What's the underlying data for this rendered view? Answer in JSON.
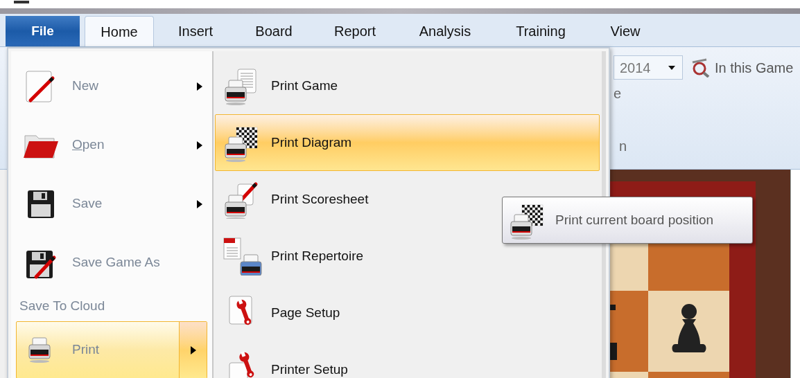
{
  "tabs": [
    {
      "label": "File",
      "kind": "file",
      "selected": false
    },
    {
      "label": "Home",
      "kind": "tab",
      "selected": true
    },
    {
      "label": "Insert",
      "kind": "tab",
      "selected": false
    },
    {
      "label": "Board",
      "kind": "tab",
      "selected": false
    },
    {
      "label": "Report",
      "kind": "tab",
      "selected": false
    },
    {
      "label": "Analysis",
      "kind": "tab",
      "selected": false
    },
    {
      "label": "Training",
      "kind": "tab",
      "selected": false
    },
    {
      "label": "View",
      "kind": "tab",
      "selected": false
    }
  ],
  "ribbon": {
    "year_dropdown": {
      "value": "2014"
    },
    "search_button": "In this Game",
    "cut_label_1": "e",
    "cut_label_2": "n"
  },
  "file_menu": {
    "left_items": [
      {
        "kind": "item",
        "label": "New",
        "underline_first_letter": false,
        "submenu": true,
        "selected": false
      },
      {
        "kind": "item",
        "label": "Open",
        "underline_first_letter": true,
        "submenu": true,
        "selected": false
      },
      {
        "kind": "item",
        "label": "Save",
        "underline_first_letter": false,
        "submenu": true,
        "selected": false
      },
      {
        "kind": "item",
        "label": "Save Game As",
        "underline_first_letter": false,
        "submenu": false,
        "selected": false
      },
      {
        "kind": "heading",
        "label": "Save To Cloud"
      },
      {
        "kind": "item",
        "label": "Print",
        "underline_first_letter": false,
        "submenu": true,
        "selected": true
      }
    ],
    "right_items": [
      {
        "label": "Print Game",
        "selected": false
      },
      {
        "label": "Print Diagram",
        "selected": true
      },
      {
        "label": "Print Scoresheet",
        "selected": false
      },
      {
        "label": "Print Repertoire",
        "selected": false
      },
      {
        "label": "Page Setup",
        "selected": false
      },
      {
        "label": "Printer Setup",
        "selected": false
      }
    ]
  },
  "tooltip": {
    "text": "Print current board position"
  }
}
